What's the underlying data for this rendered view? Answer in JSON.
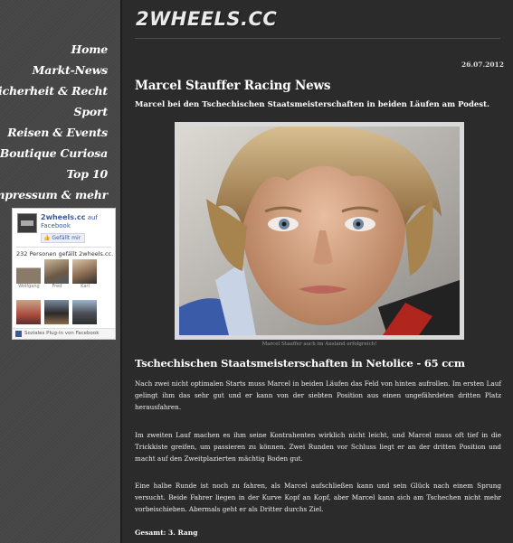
{
  "site": {
    "logo": "2WHEELS.CC"
  },
  "nav": {
    "items": [
      {
        "label": "Home"
      },
      {
        "label": "Markt-News"
      },
      {
        "label": "Sicherheit & Recht"
      },
      {
        "label": "Sport"
      },
      {
        "label": "Reisen & Events"
      },
      {
        "label": "Boutique Curiosa"
      },
      {
        "label": "Top 10"
      },
      {
        "label": "Impressum & mehr"
      }
    ]
  },
  "facebook": {
    "page_name": "2wheels.cc",
    "on": "auf",
    "network": "Facebook",
    "like_button": "Gefällt mir",
    "count_text": "232 Personen gefällt 2wheels.cc.",
    "fans": [
      {
        "name": "Wolfgang"
      },
      {
        "name": "Fred"
      },
      {
        "name": "Karl"
      }
    ],
    "plugin_text": "Soziales Plug-in von Facebook"
  },
  "article": {
    "date": "26.07.2012",
    "title": "Marcel Stauffer Racing News",
    "lead": "Marcel bei den Tschechischen Staatsmeisterschaften in beiden Läufen am Podest.",
    "photo_caption": "Marcel Stauffer auch im Ausland erfolgreich!",
    "section_title": "Tschechischen Staatsmeisterschaften in Netolice - 65 ccm",
    "paragraphs": [
      "Nach zwei nicht optimalen Starts muss Marcel in beiden Läufen das Feld von hinten aufrollen. Im ersten Lauf gelingt ihm das sehr gut und er kann von der siebten Position aus einen ungefährdeten dritten Platz herausfahren.",
      "Im zweiten Lauf machen es ihm seine Kontrahenten wirklich nicht leicht, und Marcel muss oft tief in die Trickkiste greifen, um passieren zu können. Zwei Runden vor Schluss liegt er an der dritten Position und macht auf den Zweitplazierten mächtig Boden gut.",
      "Eine halbe Runde ist noch zu fahren, als Marcel aufschließen kann und sein Glück nach einem Sprung versucht. Beide Fahrer liegen in der Kurve Kopf an Kopf, aber Marcel kann sich am Tschechen nicht mehr vorbeischieben. Abermals geht er als Dritter durchs Ziel."
    ],
    "total": "Gesamt: 3. Rang"
  }
}
